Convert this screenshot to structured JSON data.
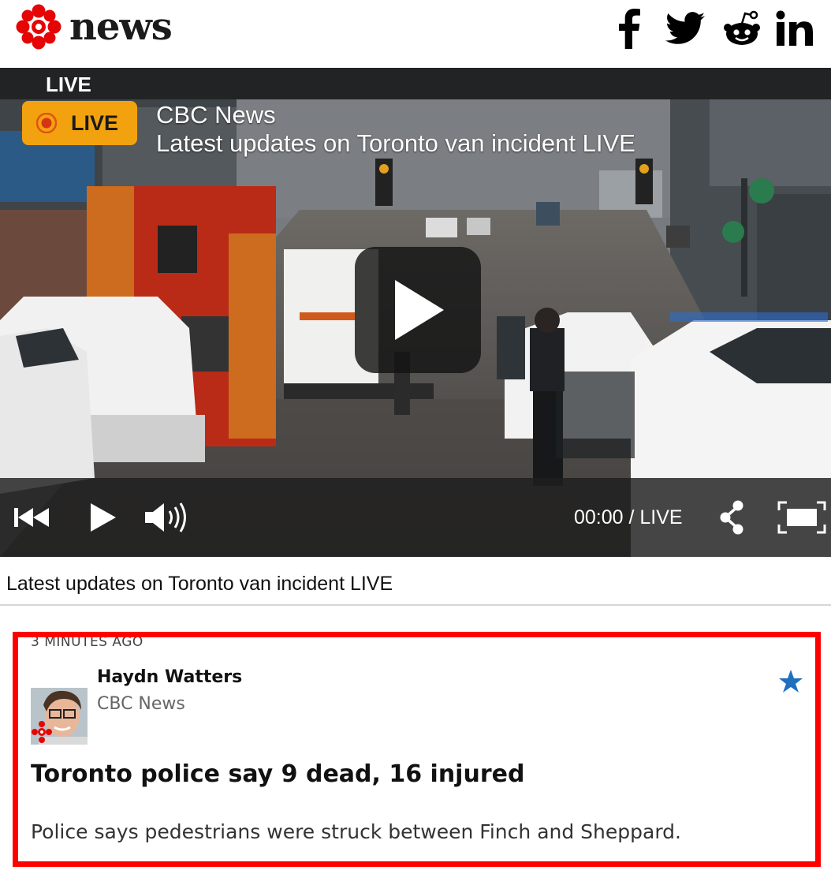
{
  "header": {
    "logo_text": "news",
    "social": [
      {
        "name": "facebook",
        "icon": "facebook-icon"
      },
      {
        "name": "twitter",
        "icon": "twitter-icon"
      },
      {
        "name": "reddit",
        "icon": "reddit-icon"
      },
      {
        "name": "linkedin",
        "icon": "linkedin-icon"
      }
    ]
  },
  "video": {
    "top_label": "LIVE",
    "badge_label": "LIVE",
    "source": "CBC News",
    "title": "Latest updates on Toronto van incident LIVE",
    "time": "00:00 / LIVE",
    "controls": [
      "rewind-icon",
      "play-icon",
      "volume-icon",
      "share-icon",
      "fullscreen-icon"
    ]
  },
  "caption": "Latest updates on Toronto van incident LIVE",
  "post": {
    "timestamp": "3 MINUTES AGO",
    "author": "Haydn Watters",
    "outlet": "CBC News",
    "headline": "Toronto police say 9 dead, 16 injured",
    "body": "Police says pedestrians were struck between Finch and Sheppard."
  },
  "colors": {
    "brand_red": "#e60505",
    "live_badge": "#f3a20f",
    "highlight_border": "#ff0000",
    "star_blue": "#1f6fbf"
  }
}
